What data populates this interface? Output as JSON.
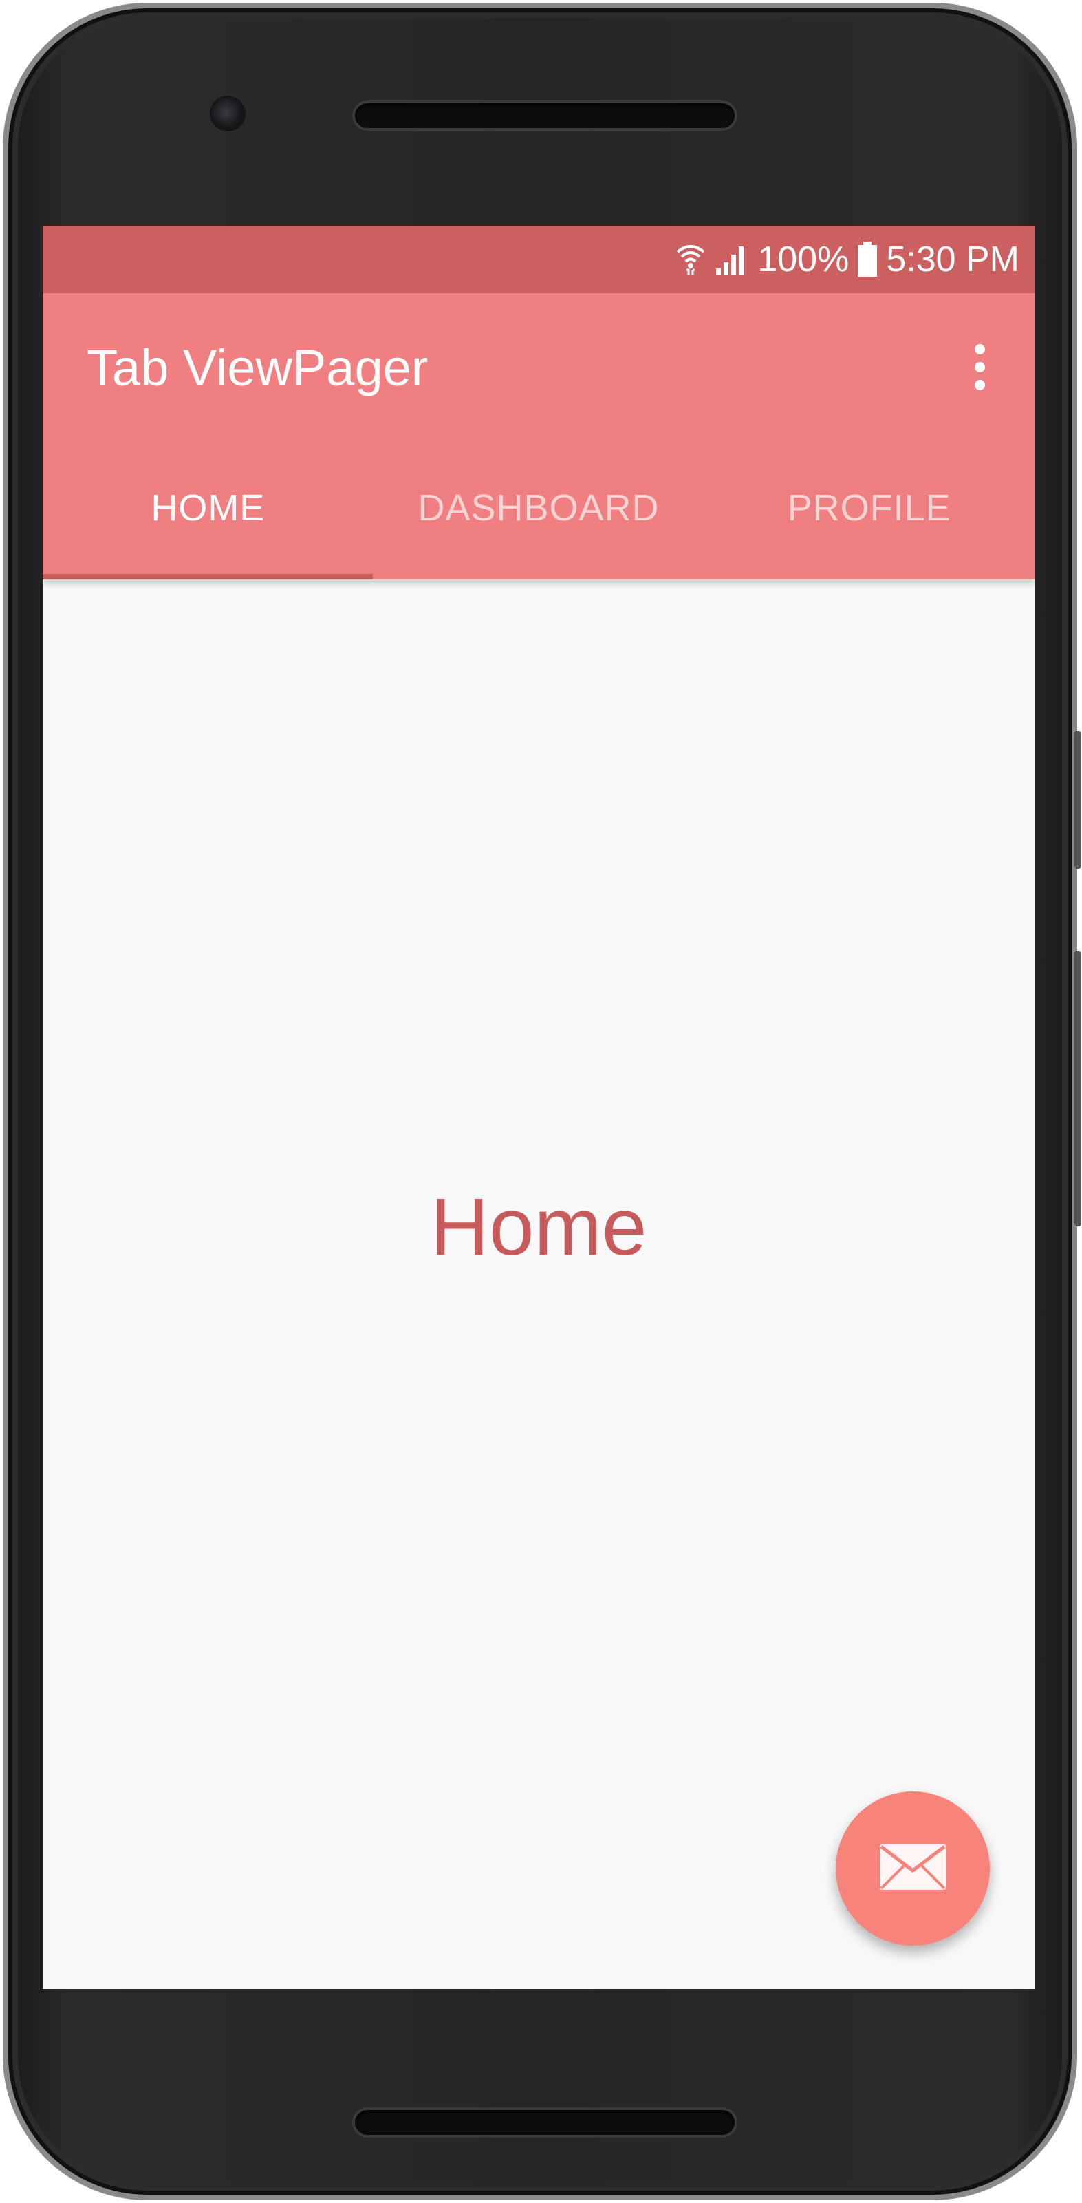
{
  "status_bar": {
    "battery": "100%",
    "time": "5:30 PM",
    "icons": [
      "wifi-icon",
      "signal-icon",
      "battery-icon"
    ]
  },
  "app_bar": {
    "title": "Tab ViewPager",
    "overflow_icon": "more-vert-icon"
  },
  "tabs": [
    {
      "label": "HOME",
      "selected": true
    },
    {
      "label": "DASHBOARD",
      "selected": false
    },
    {
      "label": "PROFILE",
      "selected": false
    }
  ],
  "content": {
    "label": "Home"
  },
  "fab": {
    "icon": "mail-icon"
  },
  "colors": {
    "status_bar": "#cc5f5f",
    "primary": "#ef7f80",
    "accent": "#f8837a",
    "content_text": "#c75a5b",
    "background": "#f8f8f8"
  }
}
